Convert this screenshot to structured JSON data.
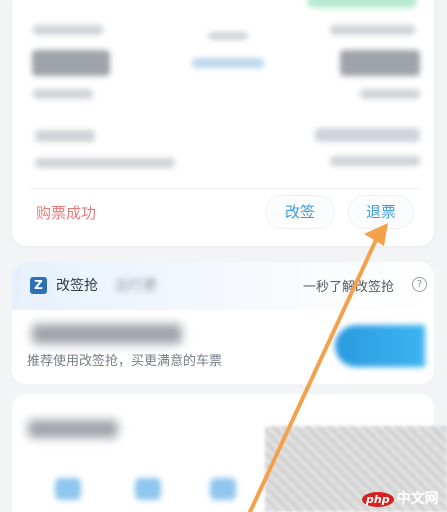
{
  "ticket": {
    "status": "购票成功",
    "change_label": "改签",
    "refund_label": "退票"
  },
  "grab": {
    "icon_letter": "Z",
    "title": "改签抢",
    "subtitle": "出行更",
    "learn_more": "一秒了解改签抢",
    "help_icon": "?",
    "recommend": "推荐使用改签抢，买更满意的车票"
  },
  "watermark": {
    "badge": "php",
    "text": "中文网"
  },
  "colors": {
    "accent_blue": "#3b9dd6",
    "status_red": "#e47b7b",
    "arrow_orange": "#f5a04a"
  }
}
